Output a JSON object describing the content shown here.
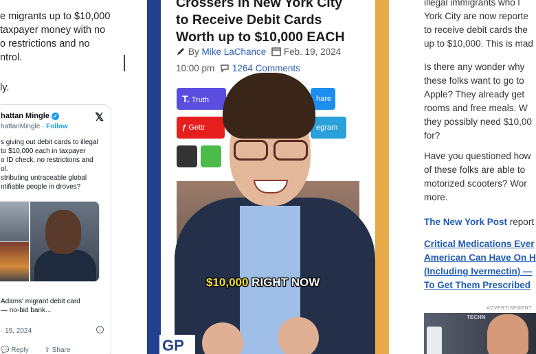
{
  "left": {
    "para_lines": [
      "e migrants up to $10,000",
      "taxpayer money with no",
      "o restrictions and no",
      "ntrol."
    ],
    "para2": "ly.",
    "tweet": {
      "name": "hattan Mingle",
      "handle": "hattanMingle · ",
      "follow": "Follow",
      "x_logo": "𝕏",
      "text_lines": [
        "s giving out debit cards to illegal",
        " to $10,000 each in taxpayer",
        "o ID check, no restrictions and",
        "ol.",
        "stributing untraceable global",
        "ntifiable people in droves?"
      ],
      "caption_lines": [
        "Adams' migrant debit card",
        "— no-bid bank..."
      ],
      "date": "· 19, 2024",
      "info": "i",
      "reply": "Reply",
      "share": "Share"
    }
  },
  "center": {
    "headline_lines": [
      "Crossers in New York City",
      "to Receive Debit Cards",
      "Worth up to $10,000 EACH"
    ],
    "by": "By ",
    "author": "Mike LaChance",
    "date": "Feb. 19, 2024",
    "time": "10:00 pm",
    "comments": "1264 Comments",
    "buttons": {
      "truth": "Truth",
      "share": "hare",
      "gettr": "Gettr",
      "telegram": "egram"
    },
    "caption_highlight": "$10,000",
    "caption_rest": " RIGHT NOW",
    "logo": "GP"
  },
  "right": {
    "p1_lines": [
      "illegal immigrants who l",
      "York City are now reporte",
      "to receive debit cards the",
      "up to $10,000. This is mad"
    ],
    "p2_lines": [
      "Is there any wonder why",
      "these folks want to go to",
      "Apple? They already get",
      "rooms and free meals. W",
      "they possibly need $10,00",
      "for?"
    ],
    "p3_lines": [
      "Have you questioned how",
      "of these folks are able to",
      "motorized scooters? Wor",
      "more."
    ],
    "p4_link": "The New York Post",
    "p4_rest": " report",
    "related_lines": [
      "Critical Medications Ever",
      "American Can Have On H",
      "(Including Ivermectin) —",
      "To Get Them Prescribed"
    ],
    "ad_label": "ADVERTISEMENT",
    "ad_tag": "TECHN"
  }
}
